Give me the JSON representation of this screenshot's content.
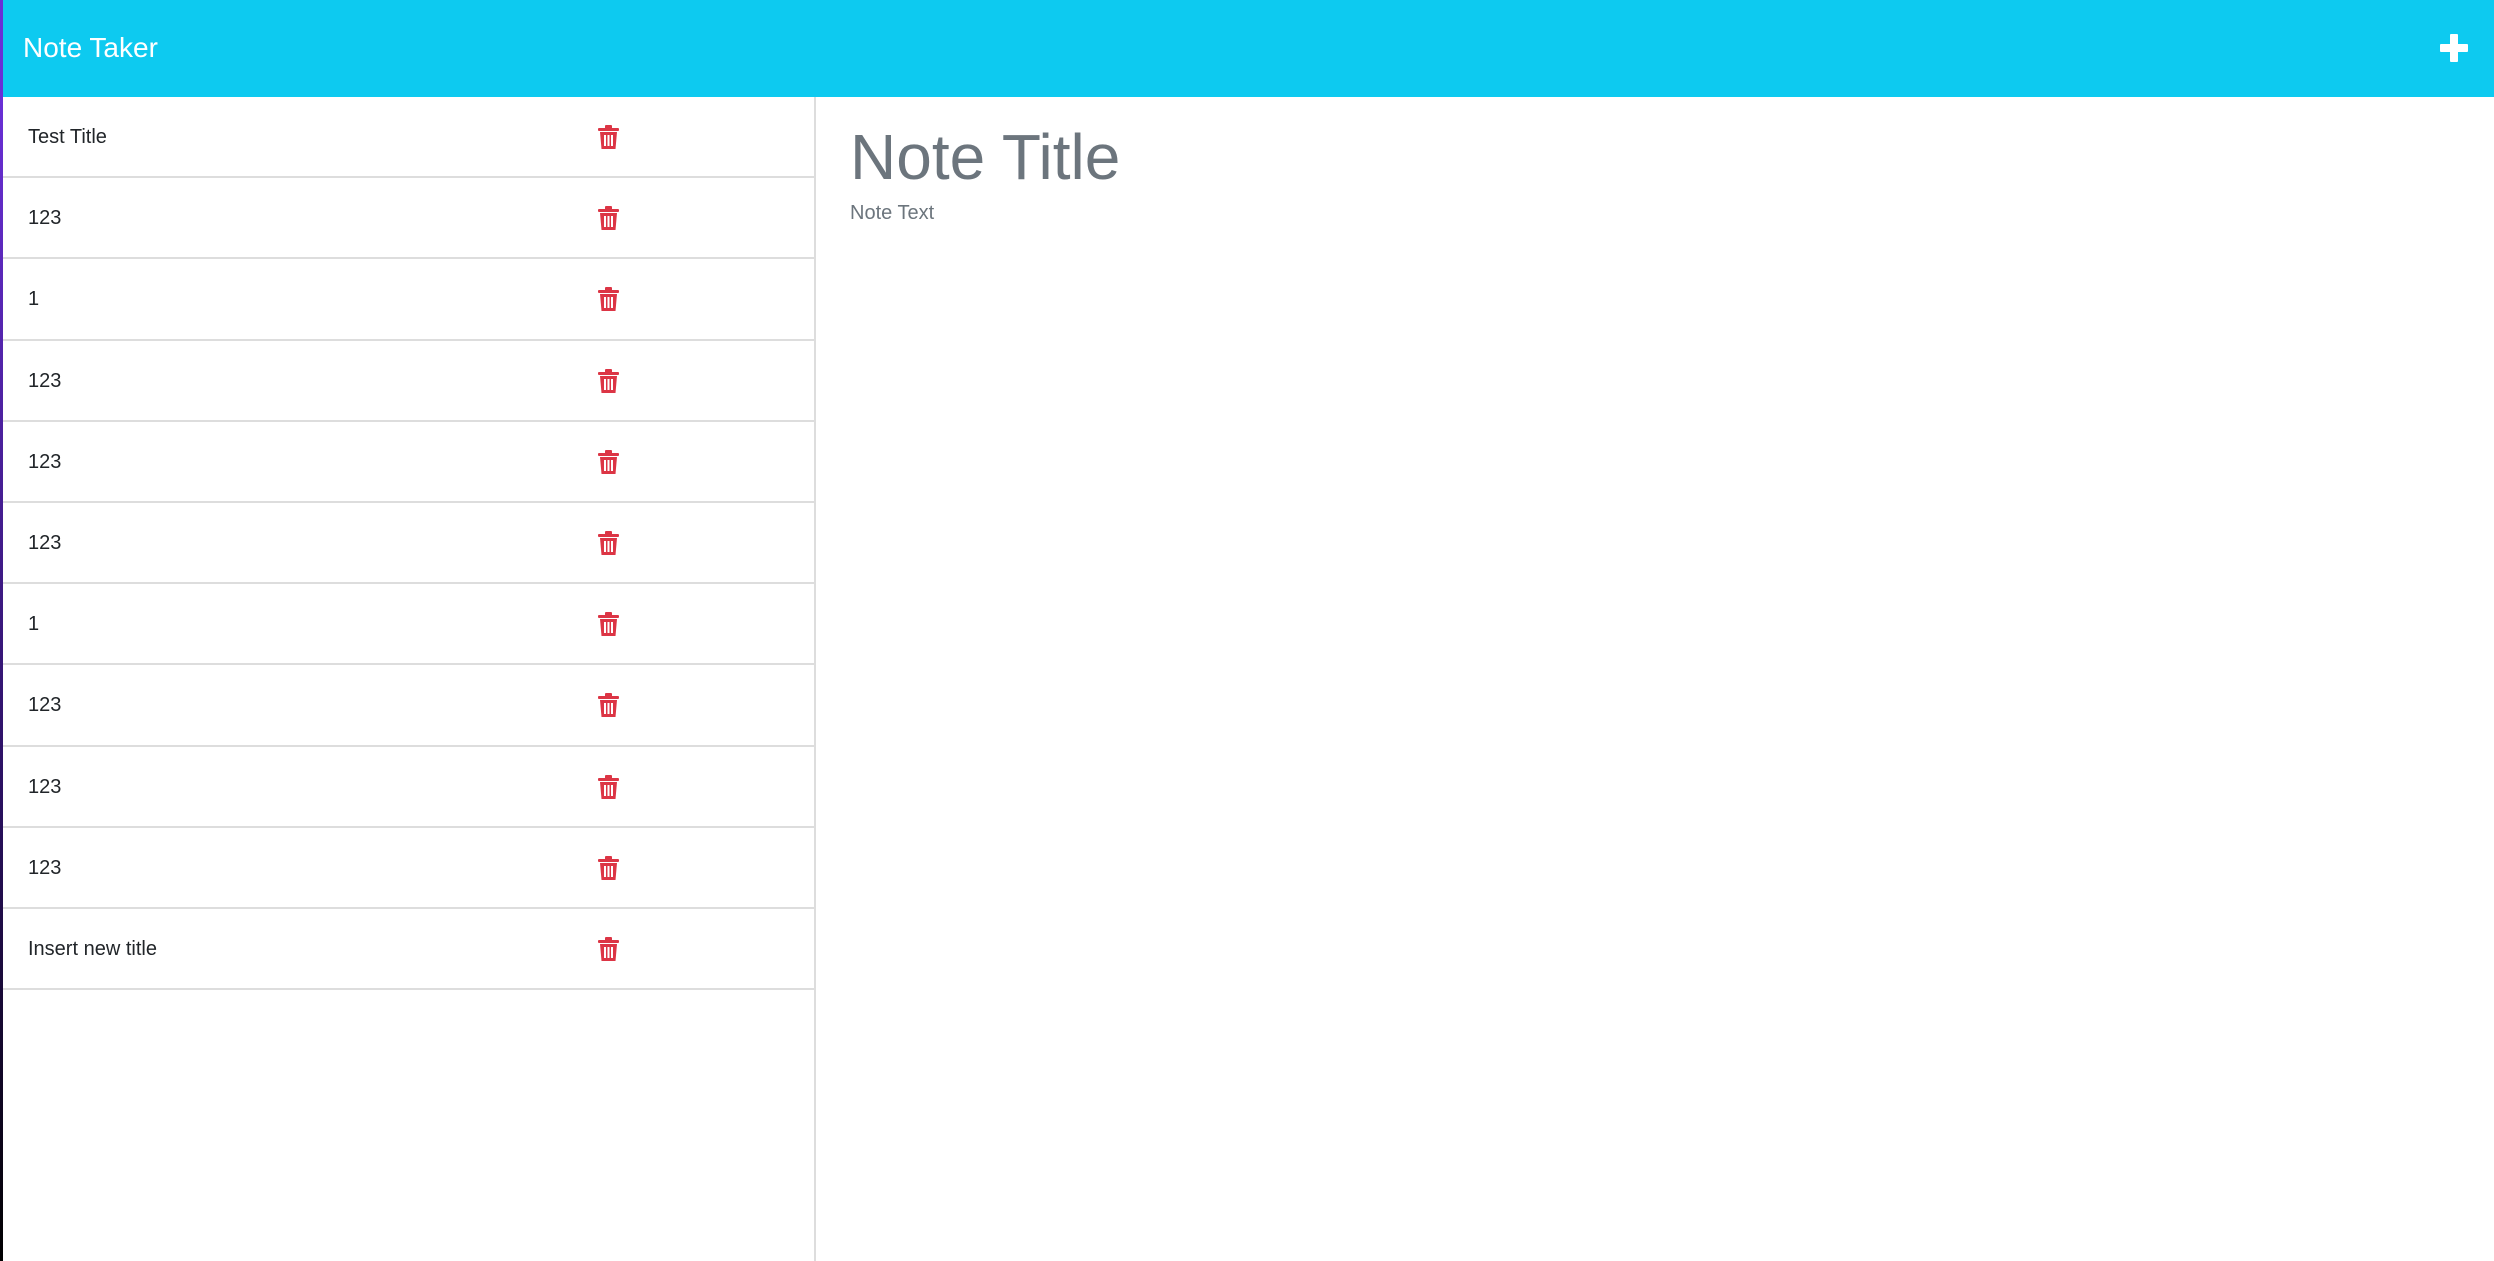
{
  "app": {
    "title": "Note Taker"
  },
  "header": {
    "new_note_icon": "plus-icon"
  },
  "notes": [
    {
      "title": "Test Title"
    },
    {
      "title": "123"
    },
    {
      "title": "1"
    },
    {
      "title": "123"
    },
    {
      "title": "123"
    },
    {
      "title": "123"
    },
    {
      "title": "1"
    },
    {
      "title": "123"
    },
    {
      "title": "123"
    },
    {
      "title": "123"
    },
    {
      "title": "Insert new title"
    }
  ],
  "editor": {
    "title_placeholder": "Note Title",
    "title_value": "",
    "text_placeholder": "Note Text",
    "text_value": ""
  },
  "colors": {
    "navbar": "#0dcaf0",
    "delete": "#dc3545",
    "placeholder": "#6c757d"
  }
}
